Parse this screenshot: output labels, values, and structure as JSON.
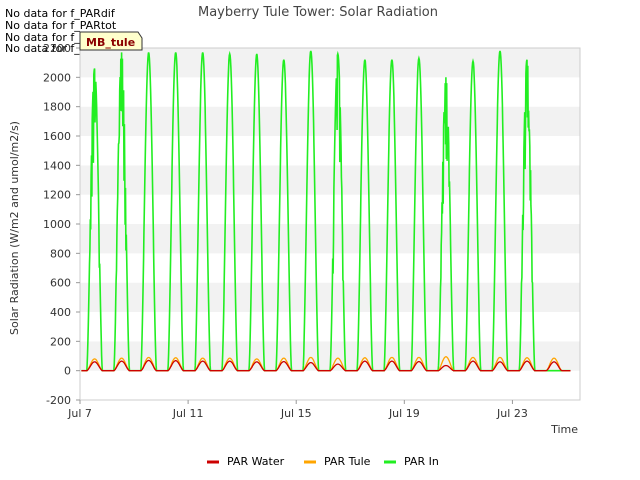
{
  "no_data_messages": [
    "No data for f_PARdif",
    "No data for f_PARtot",
    "No data for f_PARdif",
    "No data for f_PARtot"
  ],
  "badge": {
    "label": "MB_tule",
    "color": "#ffffcc"
  },
  "chart_data": {
    "type": "line",
    "title": "Mayberry Tule Tower: Solar Radiation",
    "xlabel": "Time",
    "ylabel": "Solar Radiation (W/m2 and umol/m2/s)",
    "ylim": [
      -200,
      2200
    ],
    "yticks": [
      -200,
      0,
      200,
      400,
      600,
      800,
      1000,
      1200,
      1400,
      1600,
      1800,
      2000,
      2200
    ],
    "xlim": [
      "2024-07-07T00:00",
      "2024-07-25T12:00"
    ],
    "xticks": [
      {
        "date": "2024-07-07",
        "label": "Jul 7"
      },
      {
        "date": "2024-07-11",
        "label": "Jul 11"
      },
      {
        "date": "2024-07-15",
        "label": "Jul 15"
      },
      {
        "date": "2024-07-19",
        "label": "Jul 19"
      },
      {
        "date": "2024-07-23",
        "label": "Jul 23"
      }
    ],
    "grid": "horizontal-bands",
    "legend_position": "bottom-center",
    "series": [
      {
        "name": "PAR Water",
        "color": "#cc0000",
        "days": [
          "2024-07-07",
          "2024-07-08",
          "2024-07-09",
          "2024-07-10",
          "2024-07-11",
          "2024-07-12",
          "2024-07-13",
          "2024-07-14",
          "2024-07-15",
          "2024-07-16",
          "2024-07-17",
          "2024-07-18",
          "2024-07-19",
          "2024-07-20",
          "2024-07-21",
          "2024-07-22",
          "2024-07-23",
          "2024-07-24"
        ],
        "daily_peak": [
          60,
          65,
          70,
          68,
          65,
          65,
          60,
          62,
          55,
          45,
          65,
          65,
          62,
          35,
          65,
          60,
          65,
          60
        ]
      },
      {
        "name": "PAR Tule",
        "color": "#ffa500",
        "days": [
          "2024-07-07",
          "2024-07-08",
          "2024-07-09",
          "2024-07-10",
          "2024-07-11",
          "2024-07-12",
          "2024-07-13",
          "2024-07-14",
          "2024-07-15",
          "2024-07-16",
          "2024-07-17",
          "2024-07-18",
          "2024-07-19",
          "2024-07-20",
          "2024-07-21",
          "2024-07-22",
          "2024-07-23",
          "2024-07-24"
        ],
        "daily_peak": [
          80,
          85,
          90,
          88,
          85,
          85,
          80,
          85,
          90,
          85,
          88,
          90,
          90,
          95,
          90,
          90,
          88,
          85
        ]
      },
      {
        "name": "PAR In",
        "color": "#22ee22",
        "days": [
          "2024-07-07",
          "2024-07-08",
          "2024-07-09",
          "2024-07-10",
          "2024-07-11",
          "2024-07-12",
          "2024-07-13",
          "2024-07-14",
          "2024-07-15",
          "2024-07-16",
          "2024-07-17",
          "2024-07-18",
          "2024-07-19",
          "2024-07-20",
          "2024-07-21",
          "2024-07-22",
          "2024-07-23",
          "2024-07-24"
        ],
        "daily_peak": [
          2060,
          2170,
          2170,
          2170,
          2170,
          2160,
          2160,
          2120,
          2180,
          2160,
          2120,
          2120,
          2130,
          2000,
          2110,
          2180,
          2120,
          0
        ]
      }
    ]
  }
}
